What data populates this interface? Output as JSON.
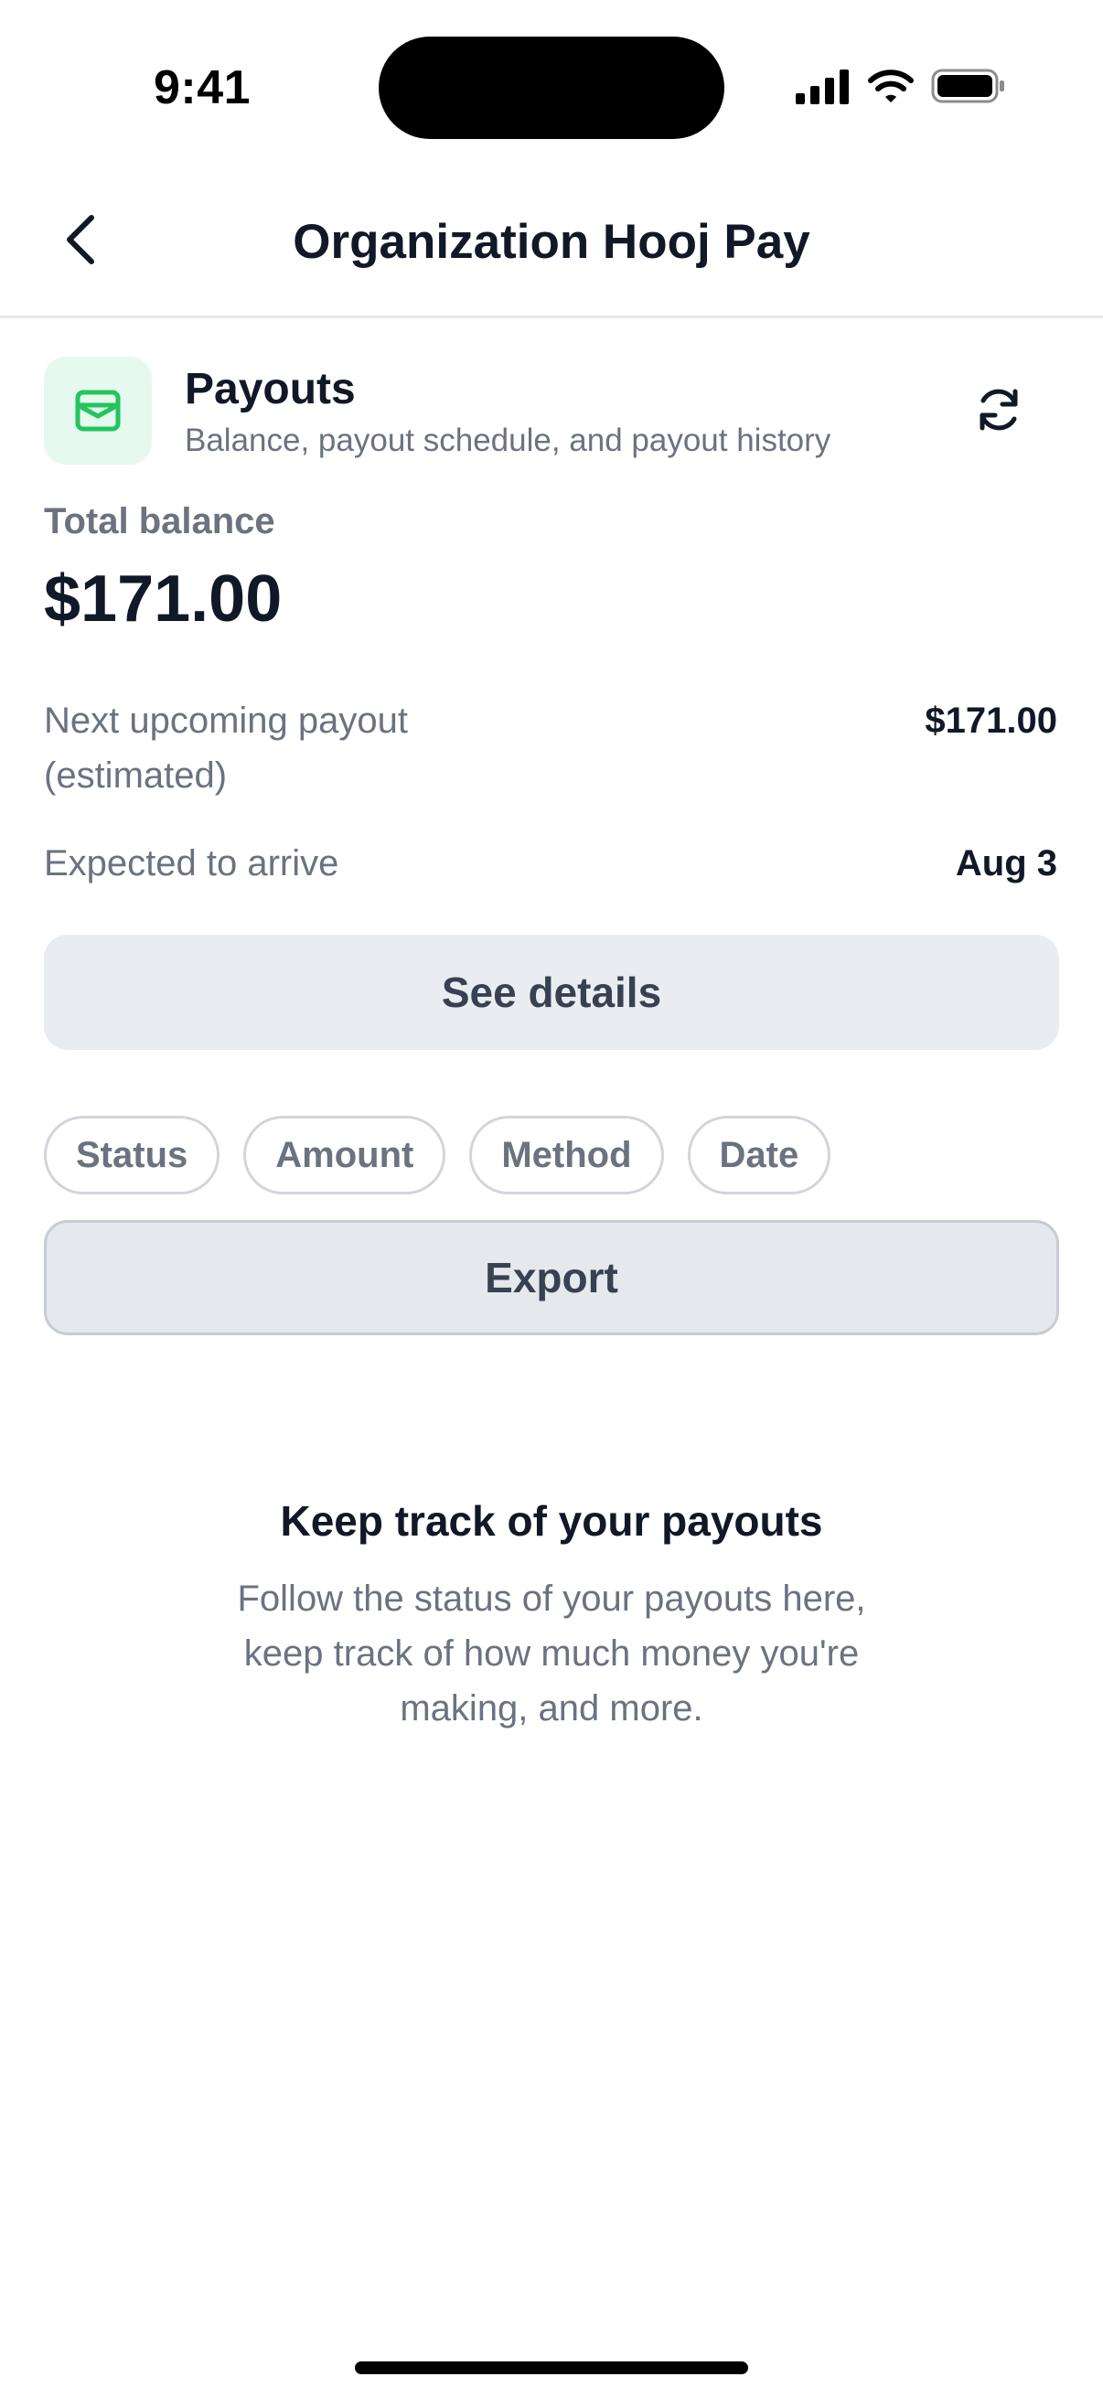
{
  "status_bar": {
    "time": "9:41",
    "icons": [
      "cellular-signal-icon",
      "wifi-icon",
      "battery-icon"
    ]
  },
  "nav": {
    "title": "Organization Hooj Pay",
    "back_icon": "chevron-left-icon"
  },
  "payouts": {
    "icon": "wallet-icon",
    "title": "Payouts",
    "subtitle": "Balance, payout schedule, and payout history",
    "refresh_icon": "refresh-icon",
    "total_label": "Total balance",
    "total_value": "$171.00",
    "next_payout_label_line1": "Next upcoming payout",
    "next_payout_label_line2": "(estimated)",
    "next_payout_value": "$171.00",
    "arrive_label": "Expected to arrive",
    "arrive_value": "Aug 3",
    "see_details_label": "See details"
  },
  "filters": {
    "chips": [
      "Status",
      "Amount",
      "Method",
      "Date"
    ],
    "export_label": "Export"
  },
  "empty_state": {
    "title": "Keep track of your payouts",
    "text_line1": "Follow the status of your payouts here,",
    "text_line2": "keep track of how much money you're",
    "text_line3": "making, and more."
  },
  "colors": {
    "accent_green": "#22c55e",
    "icon_bg": "#e6f9ee",
    "button_bg": "#e9edf1",
    "text_primary": "#111827",
    "text_secondary": "#6b7280"
  }
}
